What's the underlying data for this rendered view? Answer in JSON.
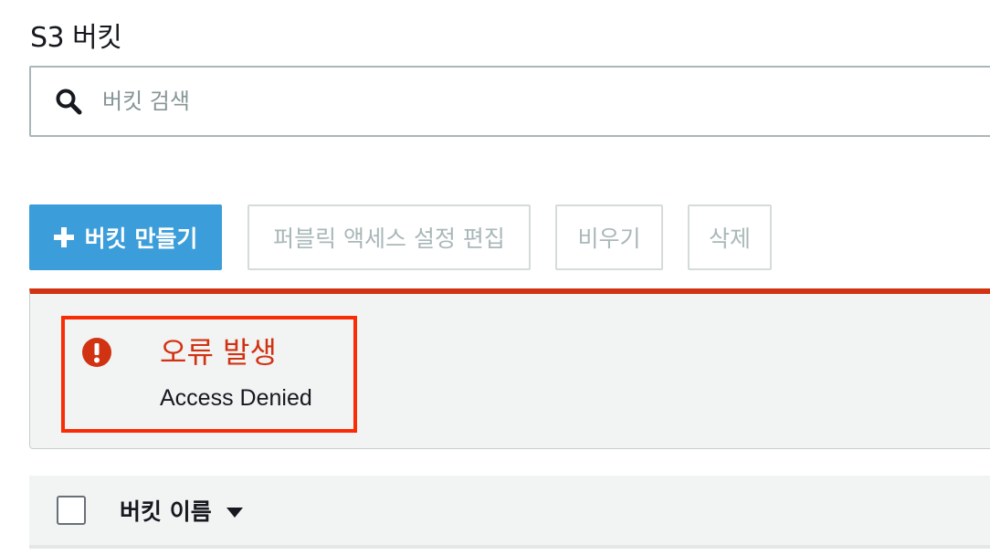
{
  "header": {
    "title": "S3 버킷"
  },
  "search": {
    "placeholder": "버킷 검색",
    "value": "",
    "icon": "search-icon"
  },
  "toolbar": {
    "create_label": "버킷 만들기",
    "edit_public_access_label": "퍼블릭 액세스 설정 편집",
    "empty_label": "비우기",
    "delete_label": "삭제"
  },
  "alert": {
    "title": "오류 발생",
    "message": "Access Denied",
    "icon": "error-icon",
    "color": "#d13212",
    "highlight_color": "#fa2c06"
  },
  "table": {
    "columns": [
      {
        "label": "버킷 이름",
        "sort": "descending"
      }
    ]
  },
  "colors": {
    "primary": "#3b9dd9",
    "error": "#d13212",
    "disabled_text": "#aab7b8"
  }
}
